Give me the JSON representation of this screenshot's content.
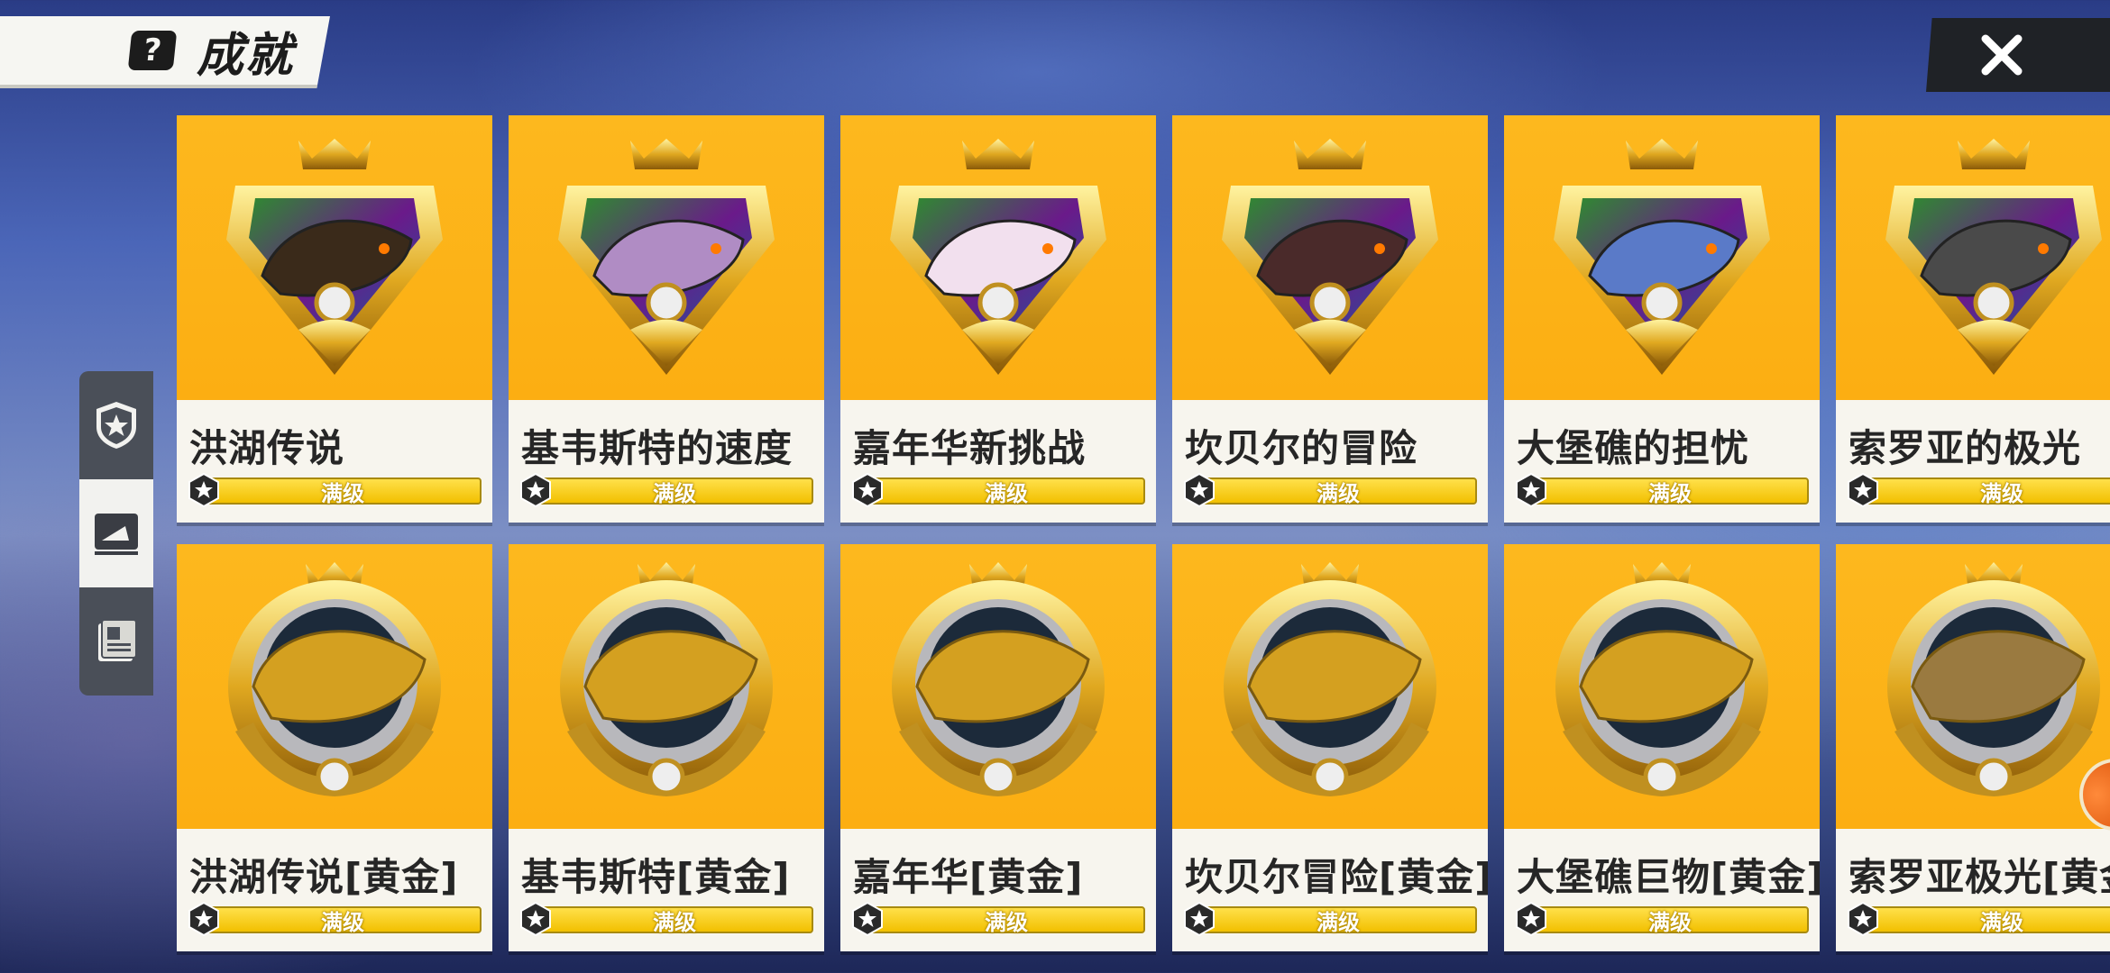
{
  "header": {
    "title": "成就",
    "help_icon": "question-mark-icon",
    "close_icon": "close-x-icon"
  },
  "side_nav": [
    {
      "name": "medal-star-icon",
      "active": false
    },
    {
      "name": "shark-card-icon",
      "active": true
    },
    {
      "name": "book-stack-icon",
      "active": false
    }
  ],
  "colors": {
    "card_bg": "#fcae12",
    "level_bar": "#f2c000",
    "close_bg": "#1f2226"
  },
  "achievements": [
    {
      "name": "洪湖传说",
      "level": "满级",
      "row": 1,
      "badge": "crown-shield",
      "fish_color": "#3a2a1a"
    },
    {
      "name": "基韦斯特的速度",
      "level": "满级",
      "row": 1,
      "badge": "crown-shield",
      "fish_color": "#b08cc4"
    },
    {
      "name": "嘉年华新挑战",
      "level": "满级",
      "row": 1,
      "badge": "crown-shield",
      "fish_color": "#f2e0ee"
    },
    {
      "name": "坎贝尔的冒险",
      "level": "满级",
      "row": 1,
      "badge": "crown-shield",
      "fish_color": "#4a2a2a"
    },
    {
      "name": "大堡礁的担忧",
      "level": "满级",
      "row": 1,
      "badge": "crown-shield",
      "fish_color": "#5a7ac8"
    },
    {
      "name": "索罗亚的极光",
      "level": "满级",
      "row": 1,
      "badge": "crown-shield",
      "fish_color": "#4a4a4a"
    },
    {
      "name": "洪湖传说[黄金]",
      "level": "满级",
      "row": 2,
      "badge": "gold-wreath",
      "fish_color": "#d4a020"
    },
    {
      "name": "基韦斯特[黄金]",
      "level": "满级",
      "row": 2,
      "badge": "gold-wreath",
      "fish_color": "#d4a020"
    },
    {
      "name": "嘉年华[黄金]",
      "level": "满级",
      "row": 2,
      "badge": "gold-wreath",
      "fish_color": "#d4a020"
    },
    {
      "name": "坎贝尔冒险[黄金]",
      "level": "满级",
      "row": 2,
      "badge": "gold-wreath",
      "fish_color": "#d4a020"
    },
    {
      "name": "大堡礁巨物[黄金]",
      "level": "满级",
      "row": 2,
      "badge": "gold-wreath",
      "fish_color": "#d4a020"
    },
    {
      "name": "索罗亚极光[黄金]",
      "level": "满级",
      "row": 2,
      "badge": "gold-wreath",
      "fish_color": "#9a7a40"
    }
  ]
}
